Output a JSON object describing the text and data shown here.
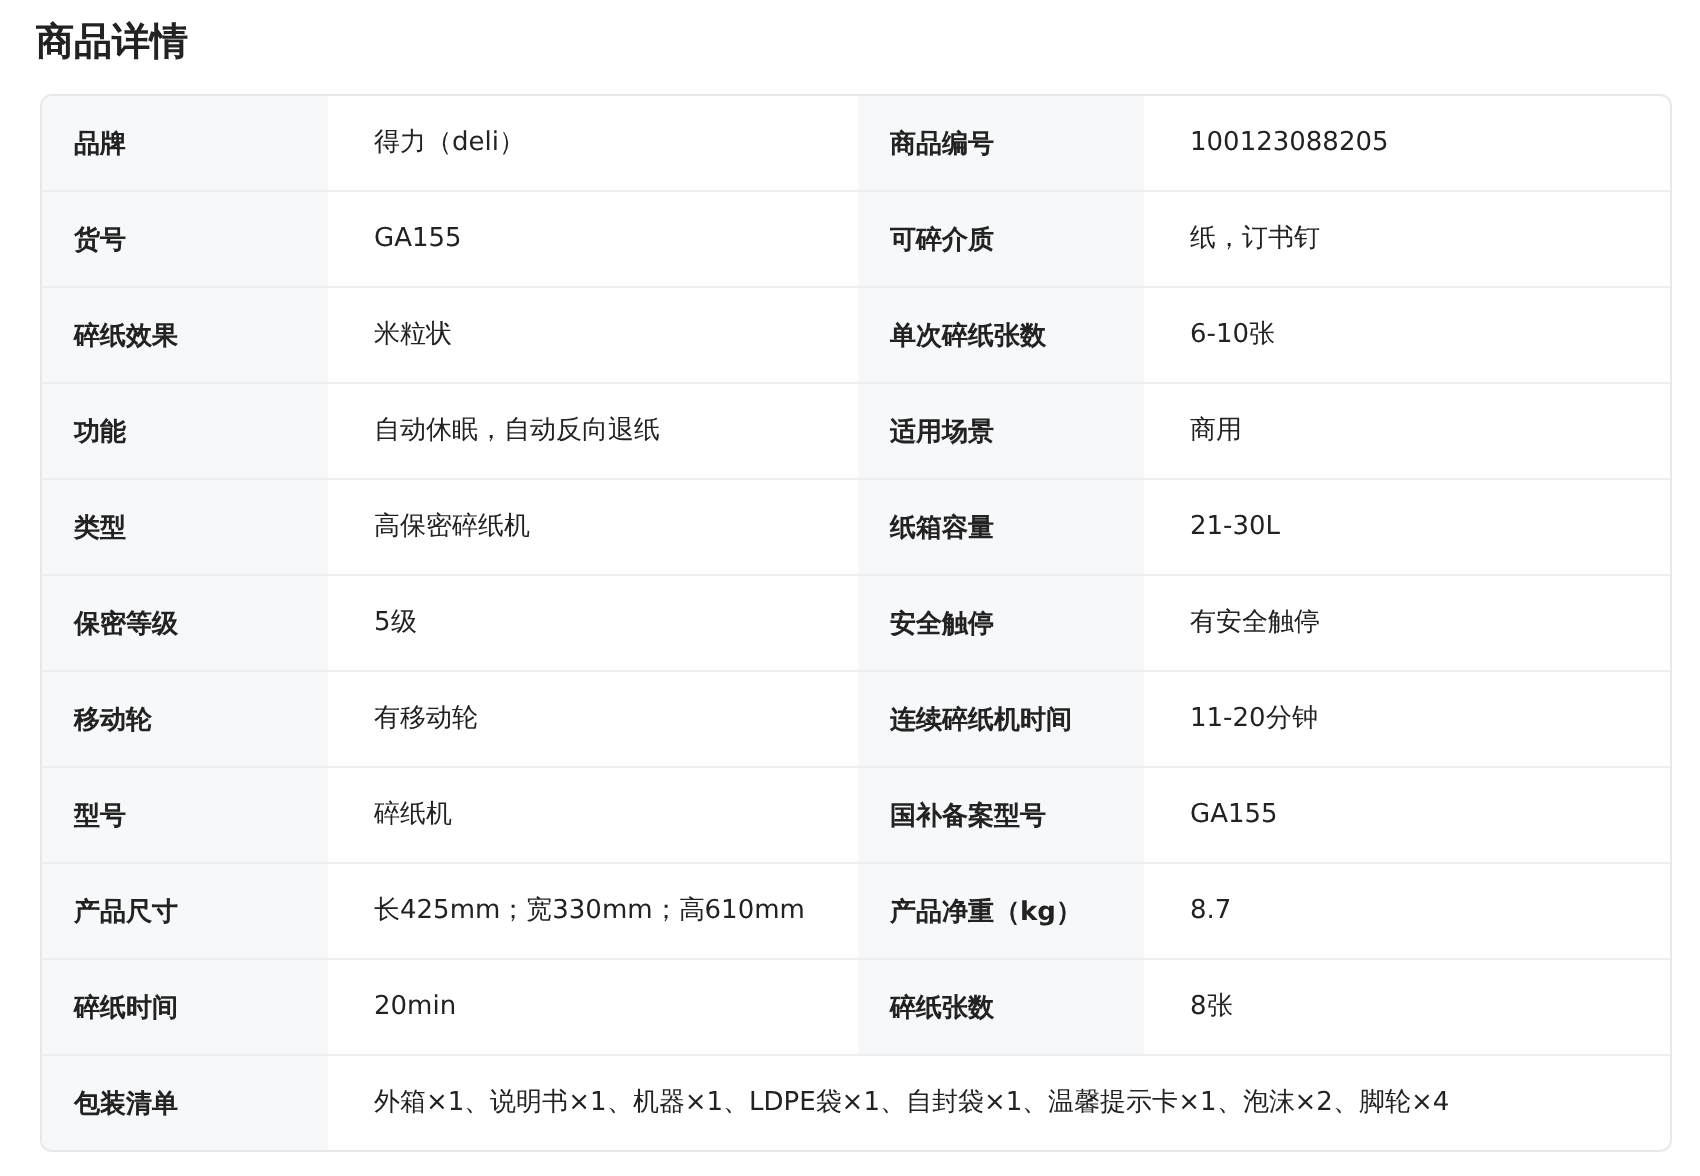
{
  "title": "商品详情",
  "rows": [
    {
      "cells": [
        {
          "label": "品牌",
          "value": "得力（deli）"
        },
        {
          "label": "商品编号",
          "value": "100123088205"
        }
      ]
    },
    {
      "cells": [
        {
          "label": "货号",
          "value": "GA155"
        },
        {
          "label": "可碎介质",
          "value": "纸，订书钉"
        }
      ]
    },
    {
      "cells": [
        {
          "label": "碎纸效果",
          "value": "米粒状"
        },
        {
          "label": "单次碎纸张数",
          "value": "6-10张"
        }
      ]
    },
    {
      "cells": [
        {
          "label": "功能",
          "value": "自动休眠，自动反向退纸"
        },
        {
          "label": "适用场景",
          "value": "商用"
        }
      ]
    },
    {
      "cells": [
        {
          "label": "类型",
          "value": "高保密碎纸机"
        },
        {
          "label": "纸箱容量",
          "value": "21-30L"
        }
      ]
    },
    {
      "cells": [
        {
          "label": "保密等级",
          "value": "5级"
        },
        {
          "label": "安全触停",
          "value": "有安全触停"
        }
      ]
    },
    {
      "cells": [
        {
          "label": "移动轮",
          "value": "有移动轮"
        },
        {
          "label": "连续碎纸机时间",
          "value": "11-20分钟"
        }
      ]
    },
    {
      "cells": [
        {
          "label": "型号",
          "value": "碎纸机"
        },
        {
          "label": "国补备案型号",
          "value": "GA155"
        }
      ]
    },
    {
      "cells": [
        {
          "label": "产品尺寸",
          "value": "长425mm；宽330mm；高610mm"
        },
        {
          "label": "产品净重（kg）",
          "value": "8.7"
        }
      ]
    },
    {
      "cells": [
        {
          "label": "碎纸时间",
          "value": "20min"
        },
        {
          "label": "碎纸张数",
          "value": "8张"
        }
      ]
    },
    {
      "cells": [
        {
          "label": "包装清单",
          "value": "外箱×1、说明书×1、机器×1、LDPE袋×1、自封袋×1、温馨提示卡×1、泡沫×2、脚轮×4"
        }
      ]
    }
  ]
}
